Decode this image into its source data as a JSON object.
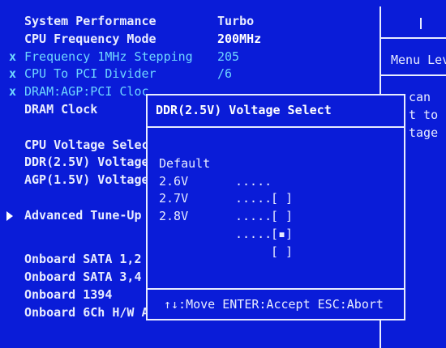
{
  "main_menu": {
    "rows": [
      {
        "label": "System Performance",
        "value": "Turbo",
        "disabled": false
      },
      {
        "label": "CPU Frequency Mode",
        "value": "200MHz",
        "disabled": false
      },
      {
        "label": "Frequency 1MHz Stepping",
        "value": "205",
        "disabled": true,
        "marker": "x"
      },
      {
        "label": "CPU To PCI Divider",
        "value": "/6",
        "disabled": true,
        "marker": "x"
      },
      {
        "label": "DRAM:AGP:PCI Cloc",
        "value": "",
        "disabled": true,
        "marker": "x"
      },
      {
        "label": "DRAM Clock",
        "value": "",
        "disabled": false
      }
    ],
    "voltage_rows": [
      {
        "label": "CPU Voltage Selec"
      },
      {
        "label": "DDR(2.5V) Voltage"
      },
      {
        "label": "AGP(1.5V) Voltage"
      }
    ],
    "advanced_tune_up": "Advanced Tune-Up",
    "onboard_rows": [
      {
        "label": "Onboard SATA 1,2"
      },
      {
        "label": "Onboard SATA 3,4"
      },
      {
        "label": "Onboard 1394"
      },
      {
        "label": "Onboard 6Ch H/W A"
      }
    ]
  },
  "help_panel": {
    "title": "Menu Lev",
    "lines": [
      "can",
      "t to",
      "tage"
    ]
  },
  "dialog": {
    "title": "DDR(2.5V) Voltage Select",
    "options": [
      {
        "label": "Default",
        "dots": ".....",
        "box": "[ ]",
        "selected": false
      },
      {
        "label": "2.6V",
        "dots": ".....",
        "box": "[ ]",
        "selected": false
      },
      {
        "label": "2.7V",
        "dots": ".....",
        "box": "[▪]",
        "selected": true
      },
      {
        "label": "2.8V",
        "dots": ".....",
        "box": "[ ]",
        "selected": false
      }
    ],
    "footer": "↑↓:Move ENTER:Accept ESC:Abort"
  },
  "colors": {
    "background": "#0a1cd8",
    "text": "#e8ecff",
    "disabled_text": "#6fd6ff"
  }
}
